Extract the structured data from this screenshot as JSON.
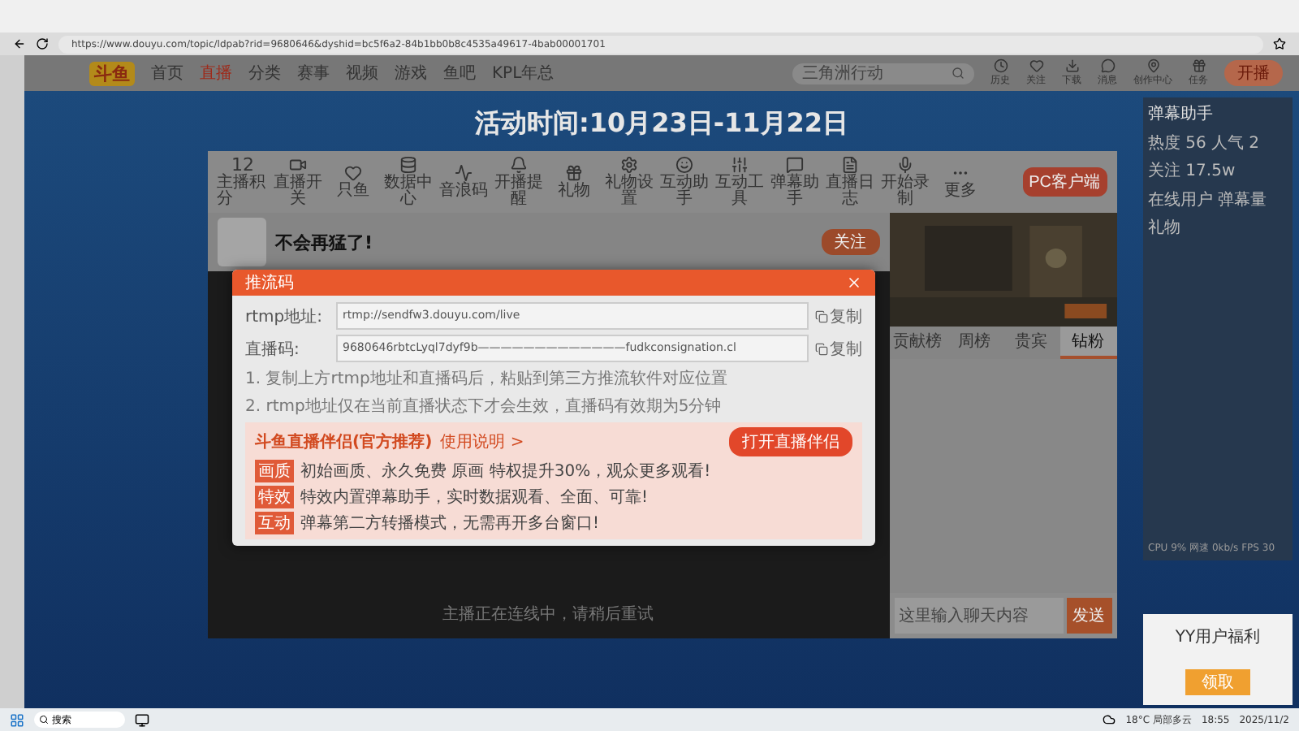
{
  "browser": {
    "url": "https://www.douyu.com/topic/ldpab?rid=9680646&dyshid=bc5f6a2-84b1bb0b8c4535a49617-4bab00001701"
  },
  "site": {
    "logo": "斗鱼",
    "nav": [
      {
        "label": "首页",
        "selected": false
      },
      {
        "label": "直播",
        "selected": true
      },
      {
        "label": "分类",
        "selected": false
      },
      {
        "label": "赛事",
        "selected": false
      },
      {
        "label": "视频",
        "selected": false
      },
      {
        "label": "游戏",
        "selected": false
      },
      {
        "label": "鱼吧",
        "selected": false
      },
      {
        "label": "KPL年总",
        "selected": false
      }
    ],
    "search": {
      "placeholder": "三角洲行动"
    },
    "actions": [
      "历史",
      "关注",
      "下载",
      "消息",
      "创作中心",
      "任务"
    ],
    "live_button": "开播"
  },
  "banner": {
    "period": "活动时间:10月23日-11月22日"
  },
  "tools": {
    "score": "12",
    "score_label": "主播积分",
    "items": [
      "直播开关",
      "只鱼",
      "数据中心",
      "音浪码",
      "开播提醒",
      "礼物",
      "礼物设置",
      "互动助手",
      "互动工具",
      "弹幕助手",
      "直播日志",
      "开始录制",
      "更多"
    ],
    "pc_button": "PC客户端"
  },
  "room": {
    "title": "不会再猛了!",
    "follow": "关注"
  },
  "stage_message": "主播正在连线中，请稍后重试",
  "dialog": {
    "title": "推流码",
    "fields": [
      {
        "label": "rtmp地址:",
        "value": "rtmp://sendfw3.douyu.com/live",
        "copy": "复制"
      },
      {
        "label": "直播码:",
        "value": "9680646rbtcLyql7dyf9b—————————————fudkconsignation.cl",
        "copy": "复制"
      }
    ],
    "notes": [
      "1. 复制上方rtmp地址和直播码后，粘贴到第三方推流软件对应位置",
      "2. rtmp地址仅在当前直播状态下才会生效，直播码有效期为5分钟"
    ],
    "promo": {
      "title": "斗鱼直播伴侣(官方推荐)",
      "link": "使用说明 >",
      "button": "打开直播伴侣",
      "lines": [
        {
          "tag": "画质",
          "text": "初始画质、永久免费 原画 特权提升30%，观众更多观看!"
        },
        {
          "tag": "特效",
          "text": "特效内置弹幕助手，实时数据观看、全面、可靠!"
        },
        {
          "tag": "互动",
          "text": "弹幕第二方转播模式，无需再开多台窗口!"
        }
      ]
    }
  },
  "chat": {
    "tabs": [
      {
        "label": "贡献榜",
        "selected": false
      },
      {
        "label": "周榜",
        "selected": false
      },
      {
        "label": "贵宾",
        "selected": false
      },
      {
        "label": "钻粉",
        "selected": true
      }
    ],
    "placeholder": "这里输入聊天内容",
    "send": "发送"
  },
  "helper": {
    "title": "弹幕助手",
    "stats": [
      "热度 56",
      "人气 2",
      "关注 17.5w"
    ],
    "tabs": [
      "在线用户",
      "弹幕量",
      "礼物"
    ],
    "footer": "CPU 9%  网速 0kb/s  FPS 30"
  },
  "notification": {
    "title": "YY用户福利",
    "button": "领取"
  },
  "taskbar": {
    "search": "搜索",
    "weather": "18°C 局部多云",
    "time": "18:55",
    "date": "2025/11/2"
  }
}
